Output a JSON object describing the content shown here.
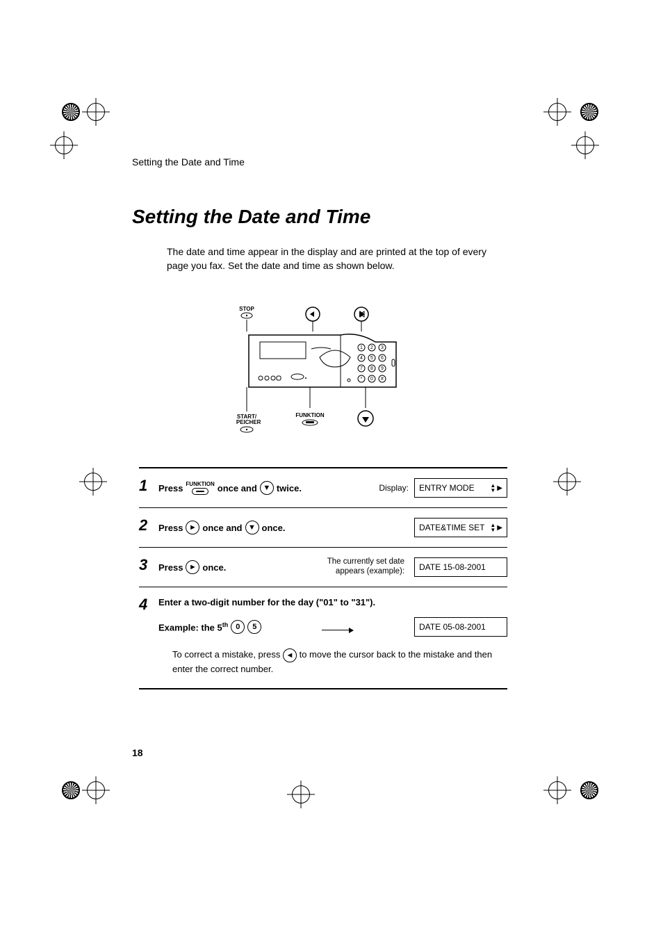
{
  "header": {
    "running_head": "Setting the Date and Time"
  },
  "section": {
    "title": "Setting the Date and Time",
    "intro": "The date and time appear in the display and are printed at the top of every page you fax. Set the date and time as shown below."
  },
  "device_labels": {
    "stop": "STOP",
    "start_speicher": "START/\nSPEICHER",
    "funktion": "FUNKTION"
  },
  "keypad": [
    "1",
    "2",
    "3",
    "4",
    "5",
    "6",
    "7",
    "8",
    "9",
    "*",
    "0",
    "#"
  ],
  "steps": {
    "s1": {
      "num": "1",
      "press": "Press",
      "funktion_label": "FUNKTION",
      "once_and": "once and",
      "twice": "twice.",
      "display_label": "Display:",
      "display_text": "ENTRY MODE"
    },
    "s2": {
      "num": "2",
      "press": "Press",
      "once_and": "once and",
      "once": "once.",
      "display_text": "DATE&TIME SET"
    },
    "s3": {
      "num": "3",
      "press": "Press",
      "once": "once.",
      "mid_l1": "The currently set date",
      "mid_l2": "appears (example):",
      "display_text": "DATE 15-08-2001"
    },
    "s4": {
      "num": "4",
      "instr": "Enter a two-digit number for the day (\"01\" to \"31\").",
      "example_prefix": "Example: the 5",
      "example_sup": "th",
      "key_a": "0",
      "key_b": "5",
      "display_text": "DATE 05-08-2001",
      "help_a": "To correct a mistake, press",
      "help_b": "to move the cursor back to the mistake and then enter the correct number."
    }
  },
  "page_number": "18",
  "icons": {
    "funktion_button": "oval-button",
    "down_circle": "▼",
    "right_circle": "►",
    "left_circle": "◄"
  }
}
